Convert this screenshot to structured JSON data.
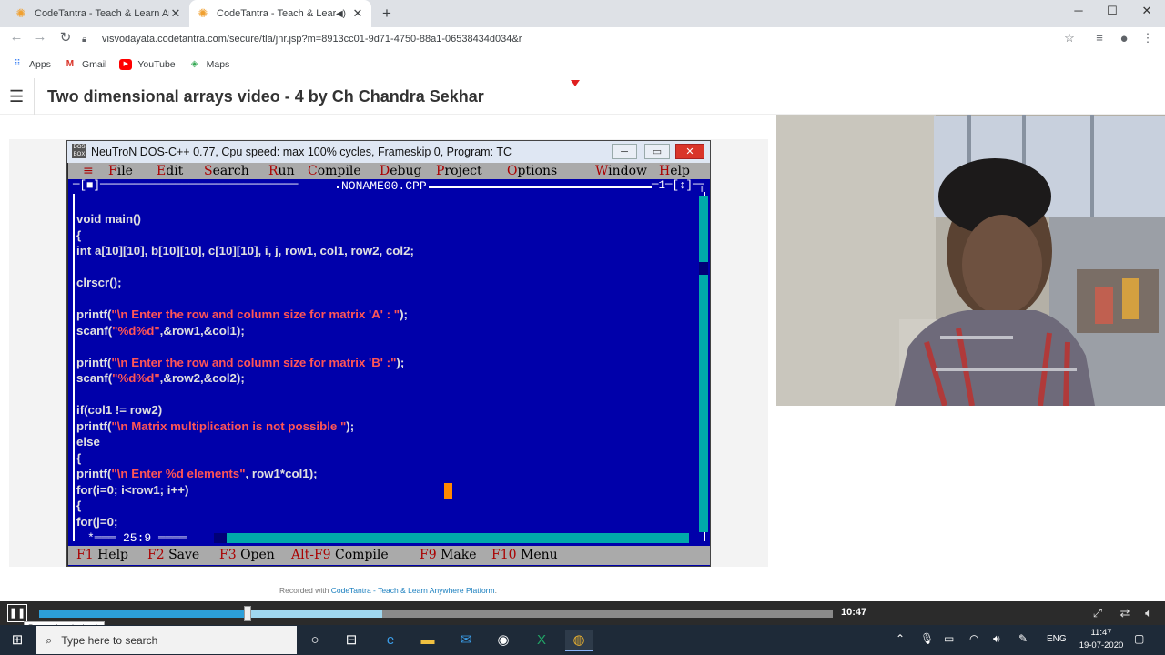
{
  "browser": {
    "tabs": [
      {
        "title": "CodeTantra - Teach & Learn Anyw",
        "active": false
      },
      {
        "title": "CodeTantra - Teach & Learn",
        "active": true
      }
    ],
    "url": "visvodayata.codetantra.com/secure/tla/jnr.jsp?m=8913cc01-9d71-4750-88a1-06538434d034&r",
    "bookmarks": [
      {
        "label": "Apps",
        "icon": "apps-grid-icon"
      },
      {
        "label": "Gmail",
        "icon": "gmail-icon"
      },
      {
        "label": "YouTube",
        "icon": "youtube-icon"
      },
      {
        "label": "Maps",
        "icon": "maps-icon"
      }
    ]
  },
  "page": {
    "title": "Two dimensional arrays video - 4 by Ch Chandra Sekhar",
    "recorded_prefix": "Recorded with ",
    "recorded_link": "CodeTantra - Teach & Learn Anywhere Platform",
    "recorded_suffix": "."
  },
  "dosbox": {
    "window_title": "NeuTroN DOS-C++ 0.77, Cpu speed: max 100% cycles, Frameskip  0, Program:     TC",
    "icon_text": "DOS BOX",
    "menu": {
      "sys": "≡",
      "file": "File",
      "edit": "Edit",
      "search": "Search",
      "run": "Run",
      "compile": "Compile",
      "debug": "Debug",
      "project": "Project",
      "options": "Options",
      "window": "Window",
      "help": "Help"
    },
    "menu_hot": {
      "file": "F",
      "edit": "E",
      "search": "S",
      "run": "R",
      "compile": "C",
      "debug": "D",
      "project": "P",
      "options": "O",
      "window": "W",
      "help": "H"
    },
    "menu_rest": {
      "file": "ile",
      "edit": "dit",
      "search": "earch",
      "run": "un",
      "compile": "ompile",
      "debug": "ebug",
      "project": "roject",
      "options": "ptions",
      "window": "indow",
      "help": "elp"
    },
    "editor_top_left": "═[■]═════════════════════════════",
    "filename": "NONAME00.CPP",
    "editor_top_right": "═1═[↕]═╗",
    "cursor_pos": "*═══ 25:9 ════",
    "code": [
      {
        "a": "void main()"
      },
      {
        "a": "{"
      },
      {
        "a": "int a[10][10], b[10][10], c[10][10], i, j, row1, col1, row2, col2;"
      },
      {
        "a": ""
      },
      {
        "a": "clrscr();"
      },
      {
        "a": ""
      },
      {
        "a": "printf(",
        "s": "\"\\n Enter the row and column size for matrix 'A' : \"",
        "b": ");"
      },
      {
        "a": "scanf(",
        "s": "\"%d%d\"",
        "b": ",&row1,&col1);"
      },
      {
        "a": ""
      },
      {
        "a": "printf(",
        "s": "\"\\n Enter the row and column size for matrix 'B' :\"",
        "b": ");"
      },
      {
        "a": "scanf(",
        "s": "\"%d%d\"",
        "b": ",&row2,&col2);"
      },
      {
        "a": ""
      },
      {
        "a": "if(col1 != row2)"
      },
      {
        "a": "printf(",
        "s": "\"\\n Matrix multiplication is not possible \"",
        "b": ");"
      },
      {
        "a": "else"
      },
      {
        "a": "{"
      },
      {
        "a": "printf(",
        "s": "\"\\n Enter %d elements\"",
        "b": ", row1*col1);"
      },
      {
        "a": "for(i=0; i<row1; i++)"
      },
      {
        "a": "{"
      },
      {
        "a": "for(j=0;"
      }
    ],
    "fkeys": [
      {
        "key": "F1",
        "label": " Help"
      },
      {
        "key": "F2",
        "label": " Save"
      },
      {
        "key": "F3",
        "label": " Open"
      },
      {
        "key": "Alt-F9",
        "label": " Compile"
      },
      {
        "key": "F9",
        "label": " Make"
      },
      {
        "key": "F10",
        "label": " Menu"
      }
    ]
  },
  "player": {
    "time": "10:47",
    "progress_fraction": 0.263,
    "buffered_fraction": 0.432,
    "tooltip": "Pause the playback"
  },
  "taskbar": {
    "search_placeholder": "Type here to search",
    "lang": "ENG",
    "time": "11:47",
    "date": "19-07-2020"
  },
  "colors": {
    "dos_blue": "#0000aa",
    "dos_gray": "#aaaaaa",
    "string_red": "#ff5555",
    "progress_blue": "#2c9fd9"
  }
}
